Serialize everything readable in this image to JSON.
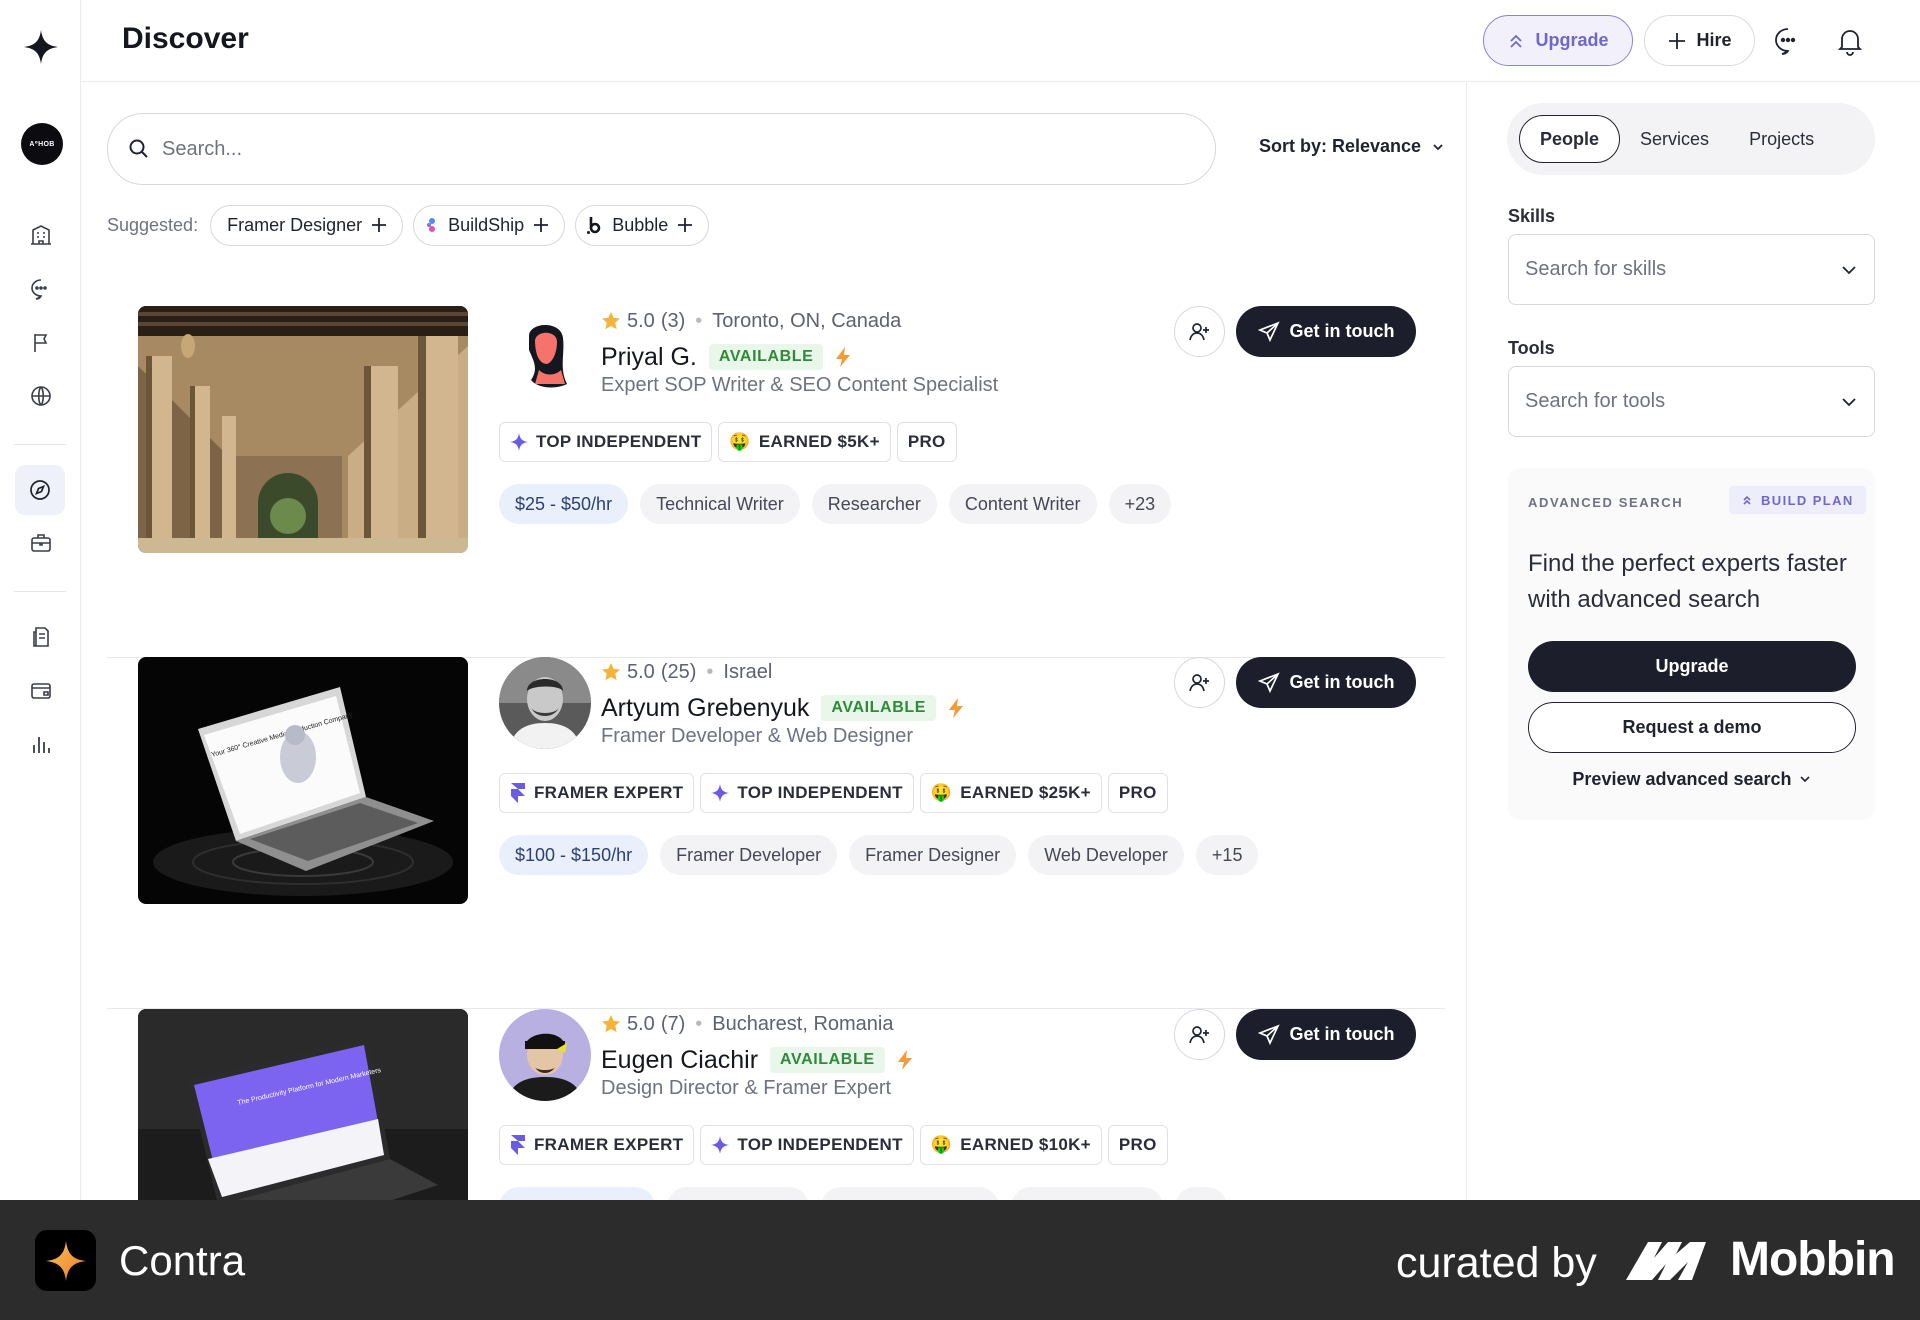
{
  "header": {
    "title": "Discover",
    "upgrade_label": "Upgrade",
    "hire_label": "Hire"
  },
  "sidebar": {
    "org_badge": "A⁰HOB",
    "items": [
      {
        "icon": "building-icon"
      },
      {
        "icon": "chat-icon"
      },
      {
        "icon": "flag-icon"
      },
      {
        "icon": "globe-icon"
      },
      {
        "icon": "compass-icon",
        "active": true
      },
      {
        "icon": "briefcase-icon"
      },
      {
        "icon": "document-icon"
      },
      {
        "icon": "wallet-icon"
      },
      {
        "icon": "bar-chart-icon"
      }
    ]
  },
  "search": {
    "placeholder": "Search...",
    "sort_label": "Sort by: Relevance"
  },
  "suggested": {
    "label": "Suggested:",
    "chips": [
      "Framer Designer",
      "BuildShip",
      "Bubble"
    ]
  },
  "profiles": [
    {
      "rating": "5.0",
      "reviews": "(3)",
      "location": "Toronto, ON, Canada",
      "name": "Priyal G.",
      "status": "AVAILABLE",
      "role": "Expert SOP Writer & SEO Content Specialist",
      "badges": [
        "TOP INDEPENDENT",
        "EARNED $5K+",
        "PRO"
      ],
      "rate": "$25 - $50/hr",
      "skills": [
        "Technical Writer",
        "Researcher",
        "Content Writer",
        "+23"
      ],
      "cta": "Get in touch"
    },
    {
      "rating": "5.0",
      "reviews": "(25)",
      "location": "Israel",
      "name": "Artyum Grebenyuk",
      "status": "AVAILABLE",
      "role": "Framer Developer & Web Designer",
      "badges": [
        "FRAMER EXPERT",
        "TOP INDEPENDENT",
        "EARNED $25K+",
        "PRO"
      ],
      "rate": "$100 - $150/hr",
      "skills": [
        "Framer Developer",
        "Framer Designer",
        "Web Developer",
        "+15"
      ],
      "cta": "Get in touch",
      "thumb_text": "Your 360° Creative Media Production Company"
    },
    {
      "rating": "5.0",
      "reviews": "(7)",
      "location": "Bucharest, Romania",
      "name": "Eugen Ciachir",
      "status": "AVAILABLE",
      "role": "Design Director & Framer Expert",
      "badges": [
        "FRAMER EXPERT",
        "TOP INDEPENDENT",
        "EARNED $10K+",
        "PRO"
      ],
      "cta": "Get in touch",
      "thumb_text": "The Productivity Platform for Modern Marketers"
    }
  ],
  "side": {
    "tabs": [
      "People",
      "Services",
      "Projects"
    ],
    "skills_label": "Skills",
    "skills_placeholder": "Search for skills",
    "tools_label": "Tools",
    "tools_placeholder": "Search for tools",
    "adv_caption": "ADVANCED SEARCH",
    "adv_plan": "BUILD PLAN",
    "adv_pitch": "Find the perfect experts faster with advanced search",
    "adv_upgrade": "Upgrade",
    "adv_demo": "Request a demo",
    "adv_preview": "Preview advanced search"
  },
  "banner": {
    "app_name": "Contra",
    "curated": "curated by",
    "brand": "Mobbin"
  },
  "colors": {
    "accent": "#6f68c9",
    "dark_button": "#1c1f2b",
    "available_text": "#2f8a3b",
    "rate_chip": "#e9f0fc"
  }
}
